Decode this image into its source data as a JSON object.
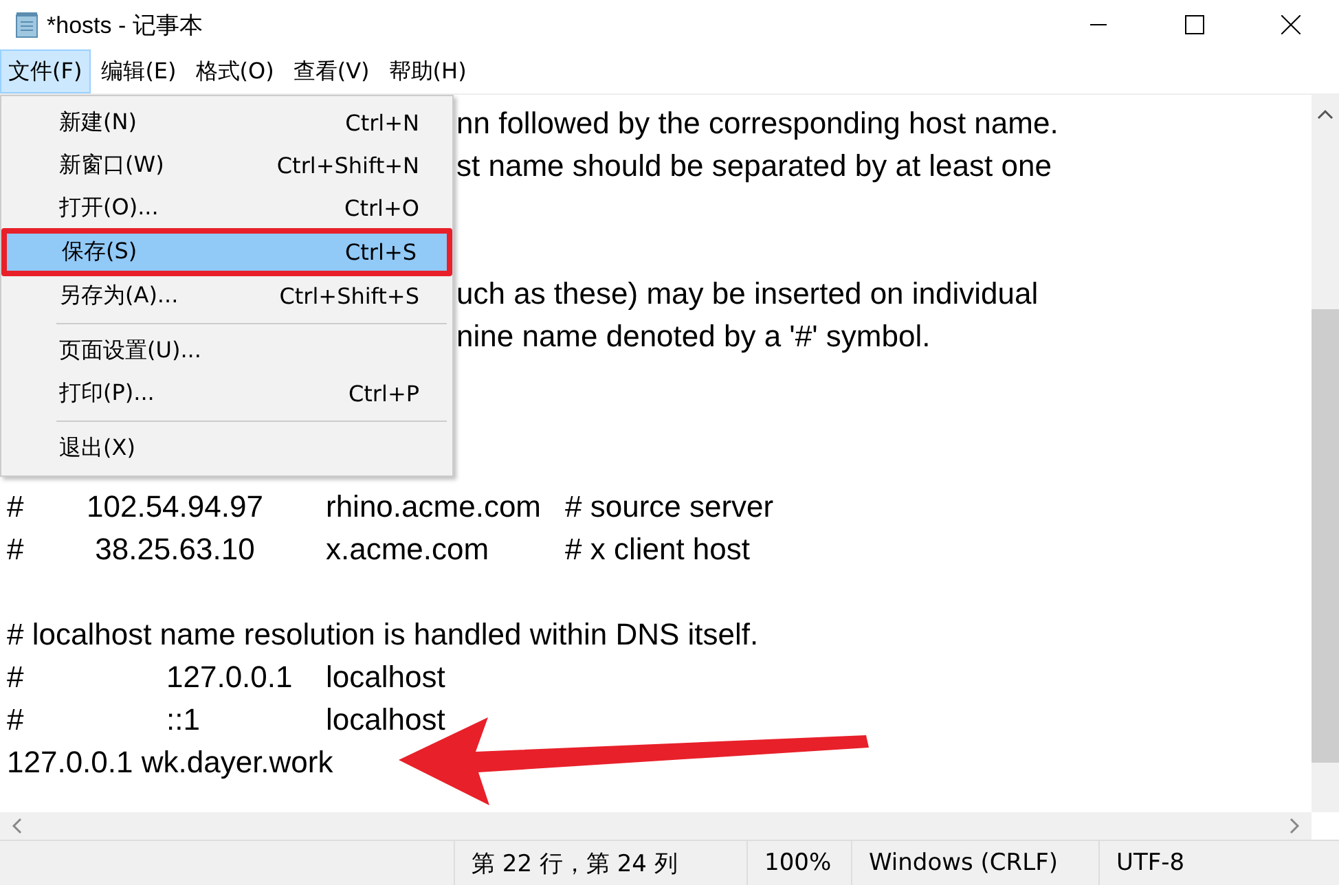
{
  "window": {
    "title": "*hosts - 记事本"
  },
  "menu_bar": [
    {
      "label": "文件(F)",
      "selected": true
    },
    {
      "label": "编辑(E)",
      "selected": false
    },
    {
      "label": "格式(O)",
      "selected": false
    },
    {
      "label": "查看(V)",
      "selected": false
    },
    {
      "label": "帮助(H)",
      "selected": false
    }
  ],
  "file_menu": {
    "items": [
      {
        "kind": "item",
        "label": "新建(N)",
        "shortcut": "Ctrl+N",
        "selected": false
      },
      {
        "kind": "item",
        "label": "新窗口(W)",
        "shortcut": "Ctrl+Shift+N",
        "selected": false
      },
      {
        "kind": "item",
        "label": "打开(O)...",
        "shortcut": "Ctrl+O",
        "selected": false
      },
      {
        "kind": "item",
        "label": "保存(S)",
        "shortcut": "Ctrl+S",
        "selected": true
      },
      {
        "kind": "item",
        "label": "另存为(A)...",
        "shortcut": "Ctrl+Shift+S",
        "selected": false
      },
      {
        "kind": "separator"
      },
      {
        "kind": "item",
        "label": "页面设置(U)...",
        "selected": false
      },
      {
        "kind": "item",
        "label": "打印(P)...",
        "shortcut": "Ctrl+P",
        "selected": false
      },
      {
        "kind": "separator"
      },
      {
        "kind": "item",
        "label": "退出(X)",
        "selected": false
      }
    ]
  },
  "editor": {
    "lines": [
      {
        "kind": "fragment",
        "text": "nn followed by the corresponding host name."
      },
      {
        "kind": "fragment",
        "text": "st name should be separated by at least one"
      },
      {
        "kind": "blank"
      },
      {
        "kind": "blank"
      },
      {
        "kind": "fragment",
        "text": "uch as these) may be inserted on individual"
      },
      {
        "kind": "fragment",
        "text": "nine name denoted by a '#' symbol."
      },
      {
        "kind": "blank"
      },
      {
        "kind": "blank"
      },
      {
        "kind": "blank"
      },
      {
        "kind": "line",
        "text": "#\t102.54.94.97\trhino.acme.com\t# source server"
      },
      {
        "kind": "line",
        "text": "#\t 38.25.63.10\tx.acme.com\t# x client host"
      },
      {
        "kind": "blank"
      },
      {
        "kind": "line",
        "text": "# localhost name resolution is handled within DNS itself."
      },
      {
        "kind": "line",
        "text": "#\t\t127.0.0.1\tlocalhost"
      },
      {
        "kind": "line",
        "text": "#\t\t::1\t\tlocalhost"
      },
      {
        "kind": "line",
        "text": "127.0.0.1 wk.dayer.work"
      }
    ]
  },
  "status_bar": {
    "position": "第 22 行，第 24 列",
    "zoom": "100%",
    "line_ending": "Windows (CRLF)",
    "encoding": "UTF-8"
  }
}
